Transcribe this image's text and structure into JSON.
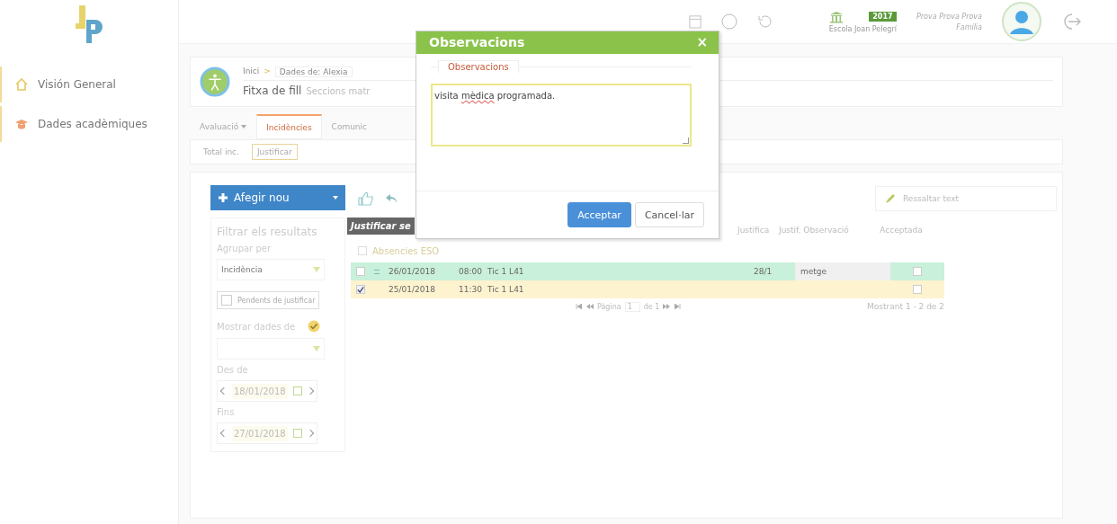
{
  "top_bar": {
    "school": "Escola Joan Pelegrí",
    "year_badge": "2017",
    "user_name": "Prova Prova Prova",
    "user_role": "Família"
  },
  "sidebar": {
    "items": [
      {
        "label": "Visión General"
      },
      {
        "label": "Dades acadèmiques"
      }
    ]
  },
  "header": {
    "breadcrumb_home": "Inici",
    "breadcrumb_separator": ">",
    "breadcrumb_current": "Dades de: Alexia",
    "title": "Fitxa de fill",
    "subtitle": "Seccions matr"
  },
  "tabs": [
    {
      "label": "Avaluació",
      "dropdown": true,
      "selected": false
    },
    {
      "label": "Incidències",
      "dropdown": false,
      "selected": true
    },
    {
      "label": "Comunic",
      "dropdown": false,
      "selected": false
    }
  ],
  "subtabs": [
    {
      "label": "Total inc.",
      "selected": false
    },
    {
      "label": "Justificar",
      "selected": true
    }
  ],
  "add_button": "Afegir nou",
  "tooltip": "Justificar se",
  "highlight_field": {
    "placeholder": "Ressaltar text"
  },
  "filters": {
    "title": "Filtrar els resultats",
    "group_label": "Agrupar per",
    "group_value": "Incidència",
    "pending": {
      "label": "Pendents de justificar",
      "checked": false
    },
    "show_label": "Mostrar dades de",
    "show_checked": true,
    "from_label": "Des de",
    "from_value": "18/01/2018",
    "to_label": "Fins",
    "to_value": "27/01/2018"
  },
  "table": {
    "columns": [
      "Justifica",
      "Justif. Observació",
      "Acceptada"
    ],
    "group": "Absencies ESO",
    "rows": [
      {
        "checked": false,
        "date": "26/01/2018",
        "time": "08:00",
        "place": "Tic 1 L41",
        "justifica": "28/1",
        "observacio": "metge",
        "accepted": false,
        "justified": true,
        "color": "#c9f0da"
      },
      {
        "checked": true,
        "date": "25/01/2018",
        "time": "11:30",
        "place": "Tic 1 L41",
        "justifica": "",
        "observacio": "",
        "accepted": false,
        "justified": false,
        "color": "#fdf3cf"
      }
    ],
    "pager": {
      "page_label": "Pàgina",
      "page": "1",
      "of": "de 1",
      "summary": "Mostrant 1 - 2 de 2"
    }
  },
  "modal": {
    "title": "Observacions",
    "close": "×",
    "legend": "Observacions",
    "text_before": "visita ",
    "text_flagged": "mèdica",
    "text_after": " programada.",
    "buttons": [
      {
        "label": "Acceptar",
        "kind": "primary"
      },
      {
        "label": "Cancel·lar",
        "kind": "default"
      }
    ]
  }
}
